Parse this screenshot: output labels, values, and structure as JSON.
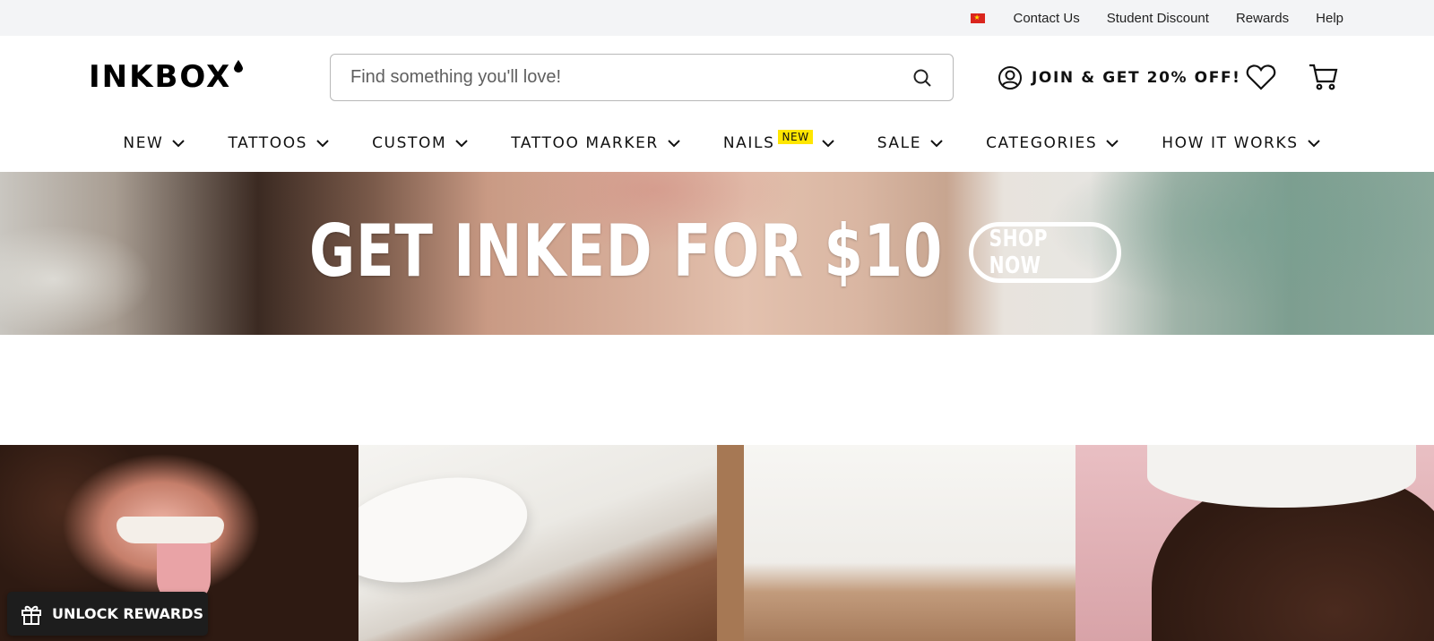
{
  "utility": {
    "flag_icon": "vietnam-flag-icon",
    "links": [
      "Contact Us",
      "Student Discount",
      "Rewards",
      "Help"
    ]
  },
  "header": {
    "logo_text": "INKBOX",
    "search_placeholder": "Find something you'll love!",
    "join_label": "JOIN & GET 20% OFF!",
    "icons": [
      "search-icon",
      "account-icon",
      "heart-icon",
      "cart-icon"
    ]
  },
  "nav": {
    "items": [
      "NEW",
      "TATTOOS",
      "CUSTOM",
      "TATTOO MARKER",
      "NAILS",
      "SALE",
      "CATEGORIES",
      "HOW IT WORKS"
    ],
    "nails_badge": "NEW"
  },
  "banner": {
    "title": "GET INKED FOR $10",
    "cta": "SHOP NOW"
  },
  "rewards_button": {
    "label": "UNLOCK REWARDS",
    "icon": "gift-icon"
  },
  "colors": {
    "badge_yellow": "#ffe600",
    "rewards_bg": "#1d1d1d",
    "utility_bg": "#f3f4f6"
  }
}
